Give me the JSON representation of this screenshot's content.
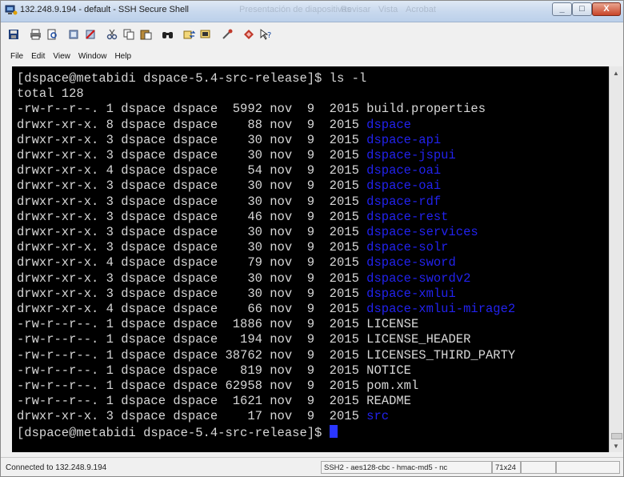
{
  "window": {
    "title": "132.248.9.194 - default - SSH Secure Shell",
    "ghost_tabs": [
      "Presentación de diapositivas",
      "Revisar",
      "Vista",
      "Acrobat"
    ],
    "controls": {
      "minimize": "_",
      "maximize": "□",
      "close": "X"
    }
  },
  "toolbar": {
    "icons": [
      "save-icon",
      "print-icon",
      "print-preview-icon",
      "quick-connect-icon",
      "disconnect-icon",
      "cut-icon",
      "copy-icon",
      "paste-icon",
      "find-icon",
      "file-transfer-icon",
      "new-terminal-icon",
      "settings-icon",
      "profiles-icon",
      "help-icon"
    ]
  },
  "menu": [
    "File",
    "Edit",
    "View",
    "Window",
    "Help"
  ],
  "terminal": {
    "lines": [
      {
        "text": "[dspace@metabidi dspace-5.4-src-release]$ ls -l",
        "name": ""
      },
      {
        "text": "total 128",
        "name": ""
      },
      {
        "text": "-rw-r--r--. 1 dspace dspace  5992 nov  9  2015 ",
        "name": "build.properties",
        "dir": false
      },
      {
        "text": "drwxr-xr-x. 8 dspace dspace    88 nov  9  2015 ",
        "name": "dspace",
        "dir": true
      },
      {
        "text": "drwxr-xr-x. 3 dspace dspace    30 nov  9  2015 ",
        "name": "dspace-api",
        "dir": true
      },
      {
        "text": "drwxr-xr-x. 3 dspace dspace    30 nov  9  2015 ",
        "name": "dspace-jspui",
        "dir": true
      },
      {
        "text": "drwxr-xr-x. 4 dspace dspace    54 nov  9  2015 ",
        "name": "dspace-oai",
        "dir": true
      },
      {
        "text": "drwxr-xr-x. 3 dspace dspace    30 nov  9  2015 ",
        "name": "dspace-oai",
        "dir": true
      },
      {
        "text": "drwxr-xr-x. 3 dspace dspace    30 nov  9  2015 ",
        "name": "dspace-rdf",
        "dir": true
      },
      {
        "text": "drwxr-xr-x. 3 dspace dspace    46 nov  9  2015 ",
        "name": "dspace-rest",
        "dir": true
      },
      {
        "text": "drwxr-xr-x. 3 dspace dspace    30 nov  9  2015 ",
        "name": "dspace-services",
        "dir": true
      },
      {
        "text": "drwxr-xr-x. 3 dspace dspace    30 nov  9  2015 ",
        "name": "dspace-solr",
        "dir": true
      },
      {
        "text": "drwxr-xr-x. 4 dspace dspace    79 nov  9  2015 ",
        "name": "dspace-sword",
        "dir": true
      },
      {
        "text": "drwxr-xr-x. 3 dspace dspace    30 nov  9  2015 ",
        "name": "dspace-swordv2",
        "dir": true
      },
      {
        "text": "drwxr-xr-x. 3 dspace dspace    30 nov  9  2015 ",
        "name": "dspace-xmlui",
        "dir": true
      },
      {
        "text": "drwxr-xr-x. 4 dspace dspace    66 nov  9  2015 ",
        "name": "dspace-xmlui-mirage2",
        "dir": true
      },
      {
        "text": "-rw-r--r--. 1 dspace dspace  1886 nov  9  2015 ",
        "name": "LICENSE",
        "dir": false
      },
      {
        "text": "-rw-r--r--. 1 dspace dspace   194 nov  9  2015 ",
        "name": "LICENSE_HEADER",
        "dir": false
      },
      {
        "text": "-rw-r--r--. 1 dspace dspace 38762 nov  9  2015 ",
        "name": "LICENSES_THIRD_PARTY",
        "dir": false
      },
      {
        "text": "-rw-r--r--. 1 dspace dspace   819 nov  9  2015 ",
        "name": "NOTICE",
        "dir": false
      },
      {
        "text": "-rw-r--r--. 1 dspace dspace 62958 nov  9  2015 ",
        "name": "pom.xml",
        "dir": false
      },
      {
        "text": "-rw-r--r--. 1 dspace dspace  1621 nov  9  2015 ",
        "name": "README",
        "dir": false
      },
      {
        "text": "drwxr-xr-x. 3 dspace dspace    17 nov  9  2015 ",
        "name": "src",
        "dir": true
      },
      {
        "text": "[dspace@metabidi dspace-5.4-src-release]$ ",
        "name": "",
        "cursor": true
      }
    ]
  },
  "status": {
    "connection": "Connected to 132.248.9.194",
    "cipher": "SSH2 - aes128-cbc - hmac-md5 - nc",
    "size": "71x24"
  },
  "colors": {
    "terminal_bg": "#000000",
    "terminal_fg": "#d7d7d7",
    "dir_color": "#2222ee",
    "cursor": "#2a36ff"
  }
}
